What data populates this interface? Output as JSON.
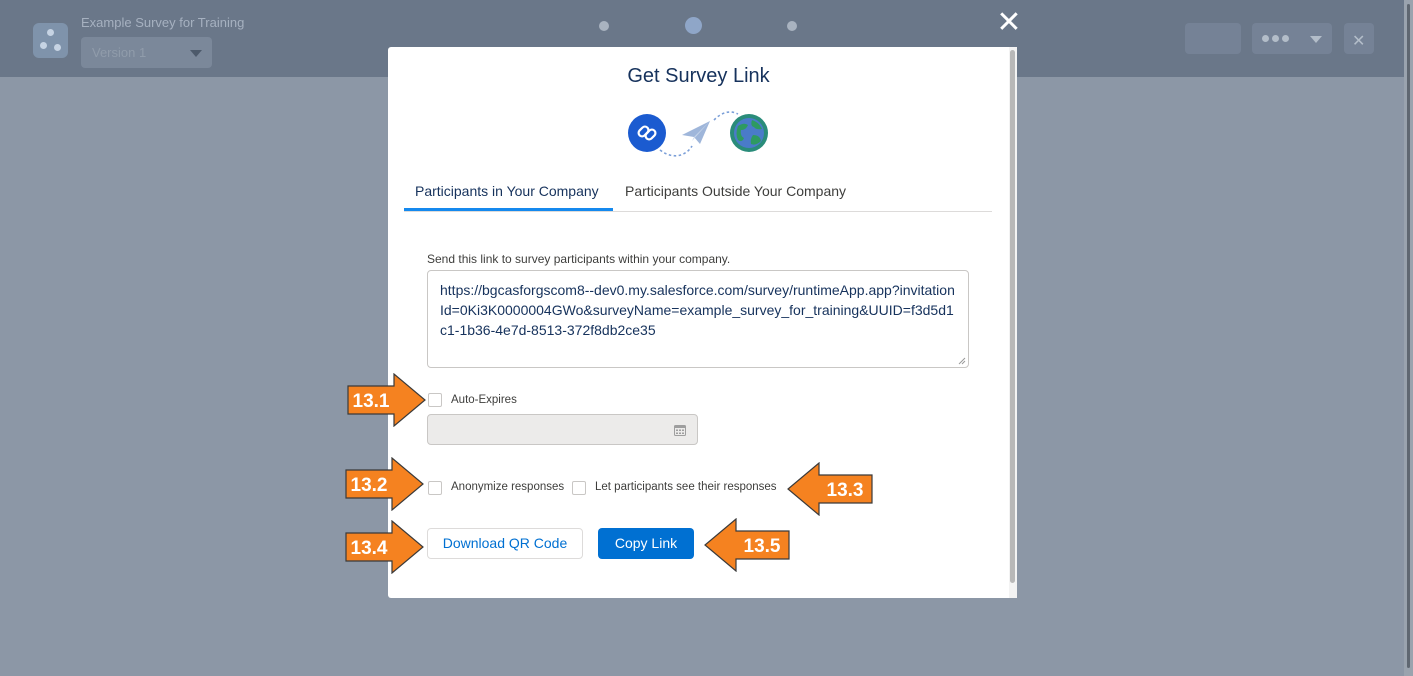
{
  "app": {
    "title": "Example Survey for Training",
    "version": "Version 1"
  },
  "modal": {
    "title": "Get Survey Link",
    "close_icon": "close-icon",
    "tabs": [
      {
        "label": "Participants in Your Company",
        "active": true
      },
      {
        "label": "Participants Outside Your Company",
        "active": false
      }
    ],
    "description": "Send this link to survey participants within your company.",
    "link": "https://bgcasforgscom8--dev0.my.salesforce.com/survey/runtimeApp.app?invitationId=0Ki3K0000004GWo&surveyName=example_survey_for_training&UUID=f3d5d1c1-1b36-4e7d-8513-372f8db2ce35",
    "auto_expires_label": "Auto-Expires",
    "anonymize_label": "Anonymize responses",
    "let_see_label": "Let participants see their responses",
    "download_qr_label": "Download QR Code",
    "copy_link_label": "Copy Link"
  },
  "callouts": {
    "c131": "13.1",
    "c132": "13.2",
    "c133": "13.3",
    "c134": "13.4",
    "c135": "13.5"
  },
  "colors": {
    "accent": "#0070d2",
    "tab_underline": "#1589ee",
    "callout": "#f58220"
  }
}
